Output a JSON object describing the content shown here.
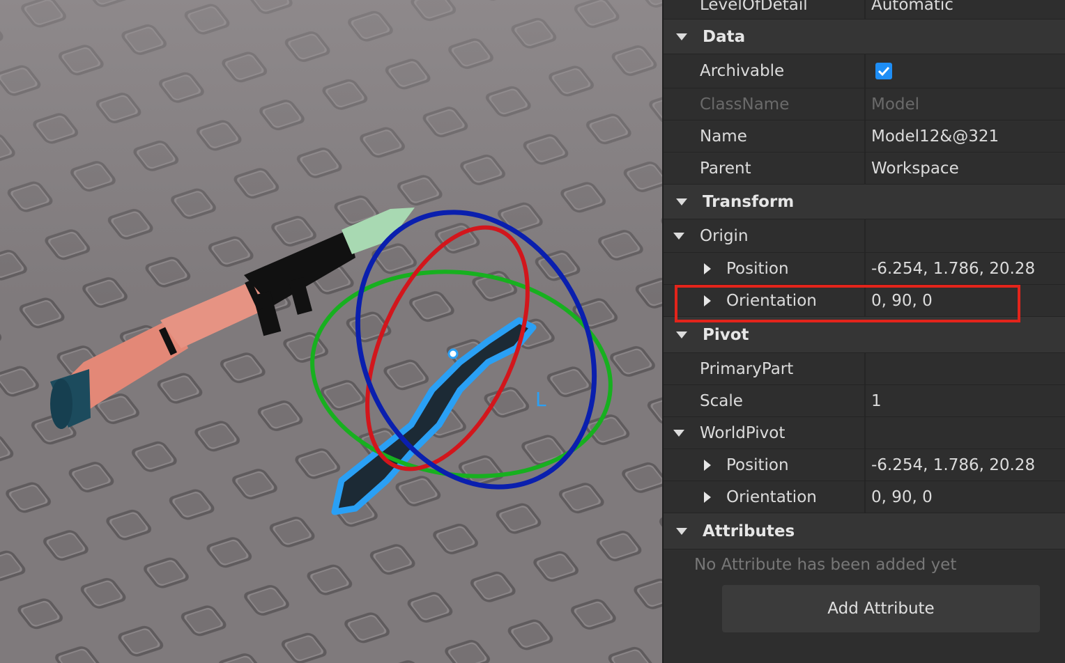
{
  "viewport": {
    "gizmo_label": "L",
    "colors": {
      "floor": "#807b7d",
      "gizmo_x": "#d2161c",
      "gizmo_y": "#17b01f",
      "gizmo_z": "#0a1fae",
      "selection": "#2aa0f5"
    }
  },
  "properties": {
    "top_row": {
      "name": "LevelOfDetail",
      "value": "Automatic"
    },
    "data_section": "Data",
    "archivable": {
      "name": "Archivable",
      "checked": true
    },
    "classname": {
      "name": "ClassName",
      "value": "Model"
    },
    "name_row": {
      "name": "Name",
      "value": "Model12&@321"
    },
    "parent": {
      "name": "Parent",
      "value": "Workspace"
    },
    "transform_section": "Transform",
    "origin": {
      "name": "Origin"
    },
    "origin_position": {
      "name": "Position",
      "value": "-6.254, 1.786, 20.28"
    },
    "origin_orientation": {
      "name": "Orientation",
      "value": "0, 90, 0"
    },
    "pivot_section": "Pivot",
    "primary_part": {
      "name": "PrimaryPart",
      "value": ""
    },
    "scale": {
      "name": "Scale",
      "value": "1"
    },
    "world_pivot": {
      "name": "WorldPivot"
    },
    "world_position": {
      "name": "Position",
      "value": "-6.254, 1.786, 20.28"
    },
    "world_orientation": {
      "name": "Orientation",
      "value": "0, 90, 0"
    },
    "attributes_section": "Attributes",
    "no_attributes": "No Attribute has been added yet",
    "add_attribute": "Add Attribute"
  },
  "highlight_color": "#e3241b"
}
